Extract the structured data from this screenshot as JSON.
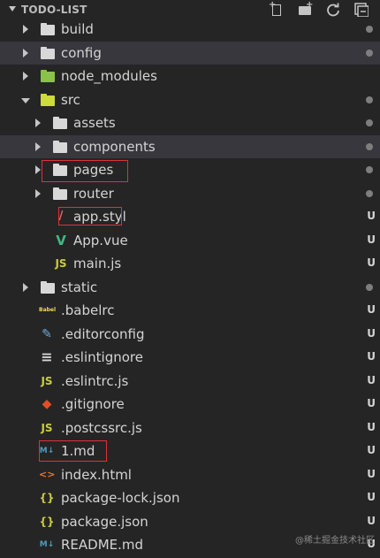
{
  "explorer": {
    "title": "TODO-LIST",
    "actions": [
      "new-file",
      "new-folder",
      "refresh",
      "collapse-all"
    ]
  },
  "tree": [
    {
      "label": "build",
      "type": "folder",
      "state": "closed",
      "depth": 0,
      "status": "dot"
    },
    {
      "label": "config",
      "type": "folder",
      "state": "closed",
      "depth": 0,
      "status": "dot",
      "selected": true
    },
    {
      "label": "node_modules",
      "type": "node-folder",
      "state": "closed",
      "depth": 0,
      "status": ""
    },
    {
      "label": "src",
      "type": "src-folder",
      "state": "open",
      "depth": 0,
      "status": "dot"
    },
    {
      "label": "assets",
      "type": "folder",
      "state": "closed",
      "depth": 1,
      "status": "dot"
    },
    {
      "label": "components",
      "type": "folder",
      "state": "closed",
      "depth": 1,
      "status": "dot",
      "selected": true
    },
    {
      "label": "pages",
      "type": "folder",
      "state": "closed",
      "depth": 1,
      "status": "dot",
      "highlight": true
    },
    {
      "label": "router",
      "type": "folder",
      "state": "closed",
      "depth": 1,
      "status": "dot"
    },
    {
      "label": "app.styl",
      "type": "styl",
      "depth": 1,
      "status": "U",
      "highlight": true
    },
    {
      "label": "App.vue",
      "type": "vue",
      "depth": 1,
      "status": "U"
    },
    {
      "label": "main.js",
      "type": "js",
      "depth": 1,
      "status": "U"
    },
    {
      "label": "static",
      "type": "folder",
      "state": "closed",
      "depth": 0,
      "status": "dot"
    },
    {
      "label": ".babelrc",
      "type": "babel",
      "depth": 0,
      "status": "U"
    },
    {
      "label": ".editorconfig",
      "type": "editorconfig",
      "depth": 0,
      "status": "U"
    },
    {
      "label": ".eslintignore",
      "type": "lines",
      "depth": 0,
      "status": "U"
    },
    {
      "label": ".eslintrc.js",
      "type": "js",
      "depth": 0,
      "status": "U"
    },
    {
      "label": ".gitignore",
      "type": "git",
      "depth": 0,
      "status": "U"
    },
    {
      "label": ".postcssrc.js",
      "type": "js",
      "depth": 0,
      "status": "U"
    },
    {
      "label": "1.md",
      "type": "md",
      "depth": 0,
      "status": "U",
      "highlight": true
    },
    {
      "label": "index.html",
      "type": "html",
      "depth": 0,
      "status": "U"
    },
    {
      "label": "package-lock.json",
      "type": "json",
      "depth": 0,
      "status": "U"
    },
    {
      "label": "package.json",
      "type": "json",
      "depth": 0,
      "status": "U"
    },
    {
      "label": "README.md",
      "type": "md",
      "depth": 0,
      "status": "U"
    }
  ],
  "watermark": "@稀土掘金技术社区",
  "colors": {
    "background": "#252526",
    "selected_row": "#37373d",
    "highlight_box": "#e0303a",
    "folder": "#d8d8d8",
    "node_folder": "#8bc34a",
    "src_folder": "#cddc39",
    "js": "#cbcb41",
    "vue": "#41b883",
    "html": "#e37933",
    "git": "#e44d26",
    "md": "#519aba",
    "json": "#cbcb41"
  }
}
